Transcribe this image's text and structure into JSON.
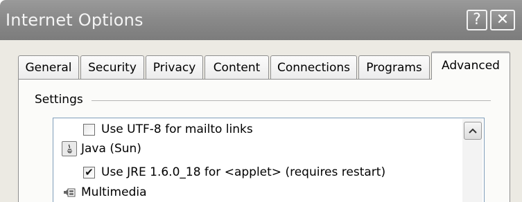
{
  "window": {
    "title": "Internet Options",
    "help_glyph": "?",
    "close_glyph": "✕"
  },
  "tabs": [
    {
      "label": "General",
      "active": false
    },
    {
      "label": "Security",
      "active": false
    },
    {
      "label": "Privacy",
      "active": false
    },
    {
      "label": "Content",
      "active": false
    },
    {
      "label": "Connections",
      "active": false
    },
    {
      "label": "Programs",
      "active": false
    },
    {
      "label": "Advanced",
      "active": true
    }
  ],
  "settings": {
    "group_label": "Settings",
    "items": [
      {
        "kind": "checkbox",
        "label": "Use UTF-8 for mailto links",
        "checked": false
      },
      {
        "kind": "category",
        "label": "Java (Sun)",
        "icon": "java-icon"
      },
      {
        "kind": "checkbox",
        "label": "Use JRE 1.6.0_18 for <applet> (requires restart)",
        "checked": true
      },
      {
        "kind": "category",
        "label": "Multimedia",
        "icon": "multimedia-icon"
      }
    ]
  },
  "icons": {
    "scroll_up": "chevron-up-icon",
    "help": "help-icon",
    "close": "close-icon"
  }
}
